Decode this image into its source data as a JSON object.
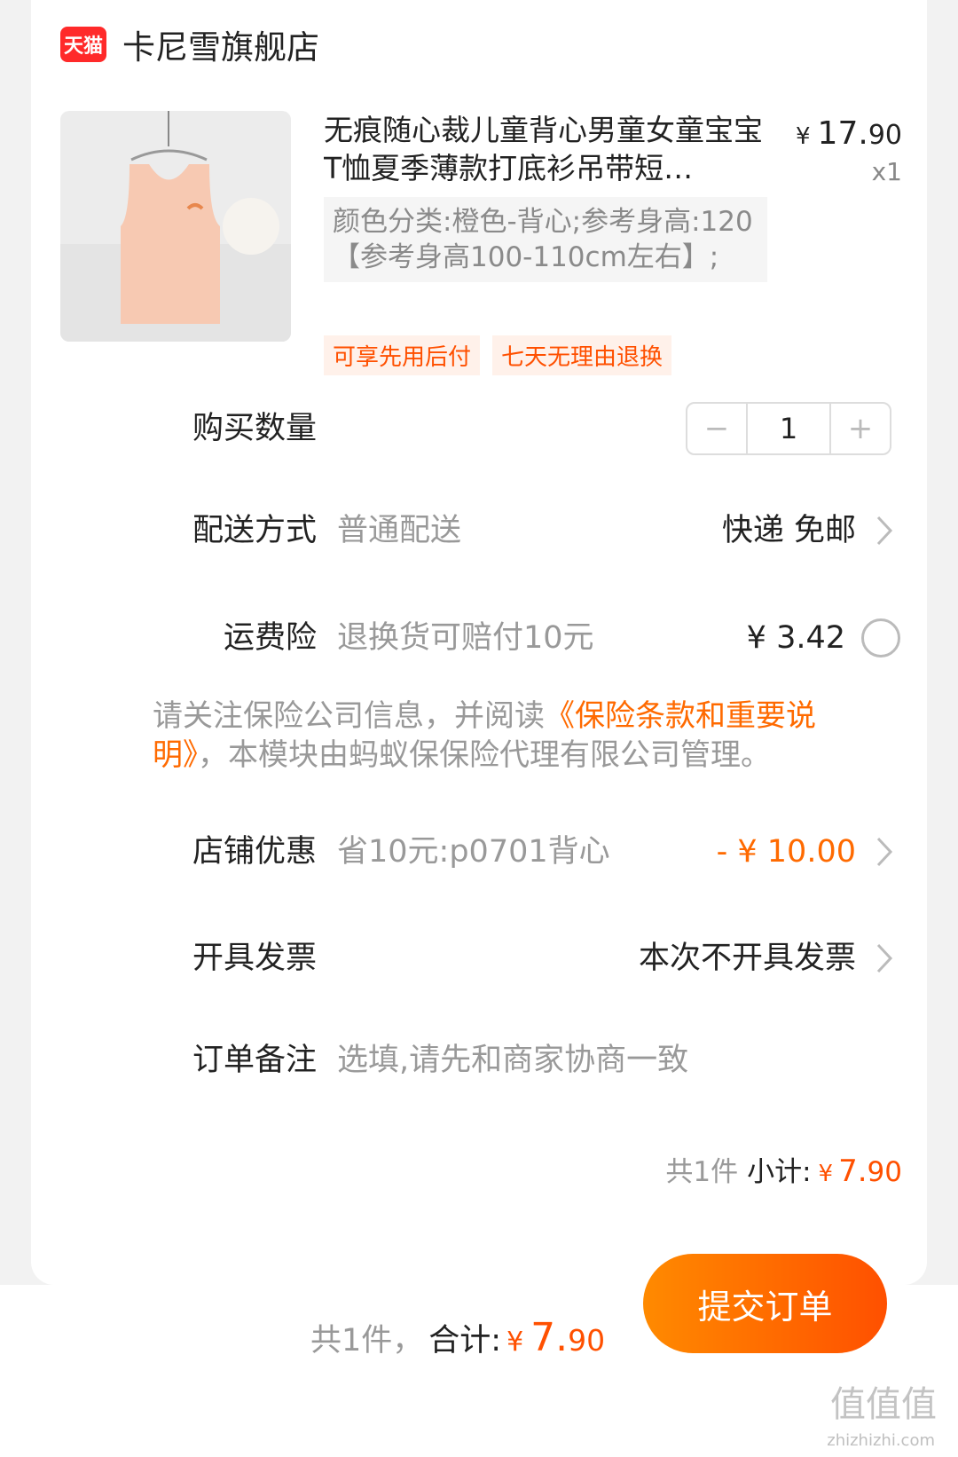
{
  "store": {
    "badge": "天猫",
    "name": "卡尼雪旗舰店"
  },
  "product": {
    "title": "无痕随心裁儿童背心男童女童宝宝T恤夏季薄款打底衫吊带短…",
    "price_yen": "¥",
    "price_int": "17.",
    "price_dec": "90",
    "quantity_x": "x1",
    "spec": "颜色分类:橙色-背心;参考身高:120【参考身高100-110cm左右】;",
    "tags": [
      "可享先用后付",
      "七天无理由退换"
    ]
  },
  "quantity": {
    "label": "购买数量",
    "value": "1",
    "minus": "−",
    "plus": "+"
  },
  "delivery": {
    "label": "配送方式",
    "desc": "普通配送",
    "value": "快递 免邮"
  },
  "insurance": {
    "label": "运费险",
    "desc": "退换货可赔付10元",
    "value": "¥ 3.42"
  },
  "notice": {
    "prefix": "请关注保险公司信息，并阅读",
    "link": "《保险条款和重要说明》",
    "suffix": "，本模块由蚂蚁保保险代理有限公司管理。"
  },
  "discount": {
    "label": "店铺优惠",
    "desc": "省10元:p0701背心",
    "value": "- ¥ 10.00"
  },
  "invoice": {
    "label": "开具发票",
    "value": "本次不开具发票"
  },
  "remark": {
    "label": "订单备注",
    "placeholder": "选填,请先和商家协商一致"
  },
  "subtotal": {
    "count": "共1件",
    "label": "小计:",
    "yen": "¥",
    "int": "7.",
    "dec": "90"
  },
  "footer": {
    "count": "共1件，",
    "label": "合计:",
    "yen": "¥",
    "int": "7.",
    "dec": "90",
    "submit": "提交订单"
  },
  "watermark": {
    "text": "值值值",
    "url": "zhizhizhi.com"
  },
  "colors": {
    "accent": "#ff5000",
    "accent_light": "#ff8a00",
    "tmall_red": "#ff2a2a"
  }
}
